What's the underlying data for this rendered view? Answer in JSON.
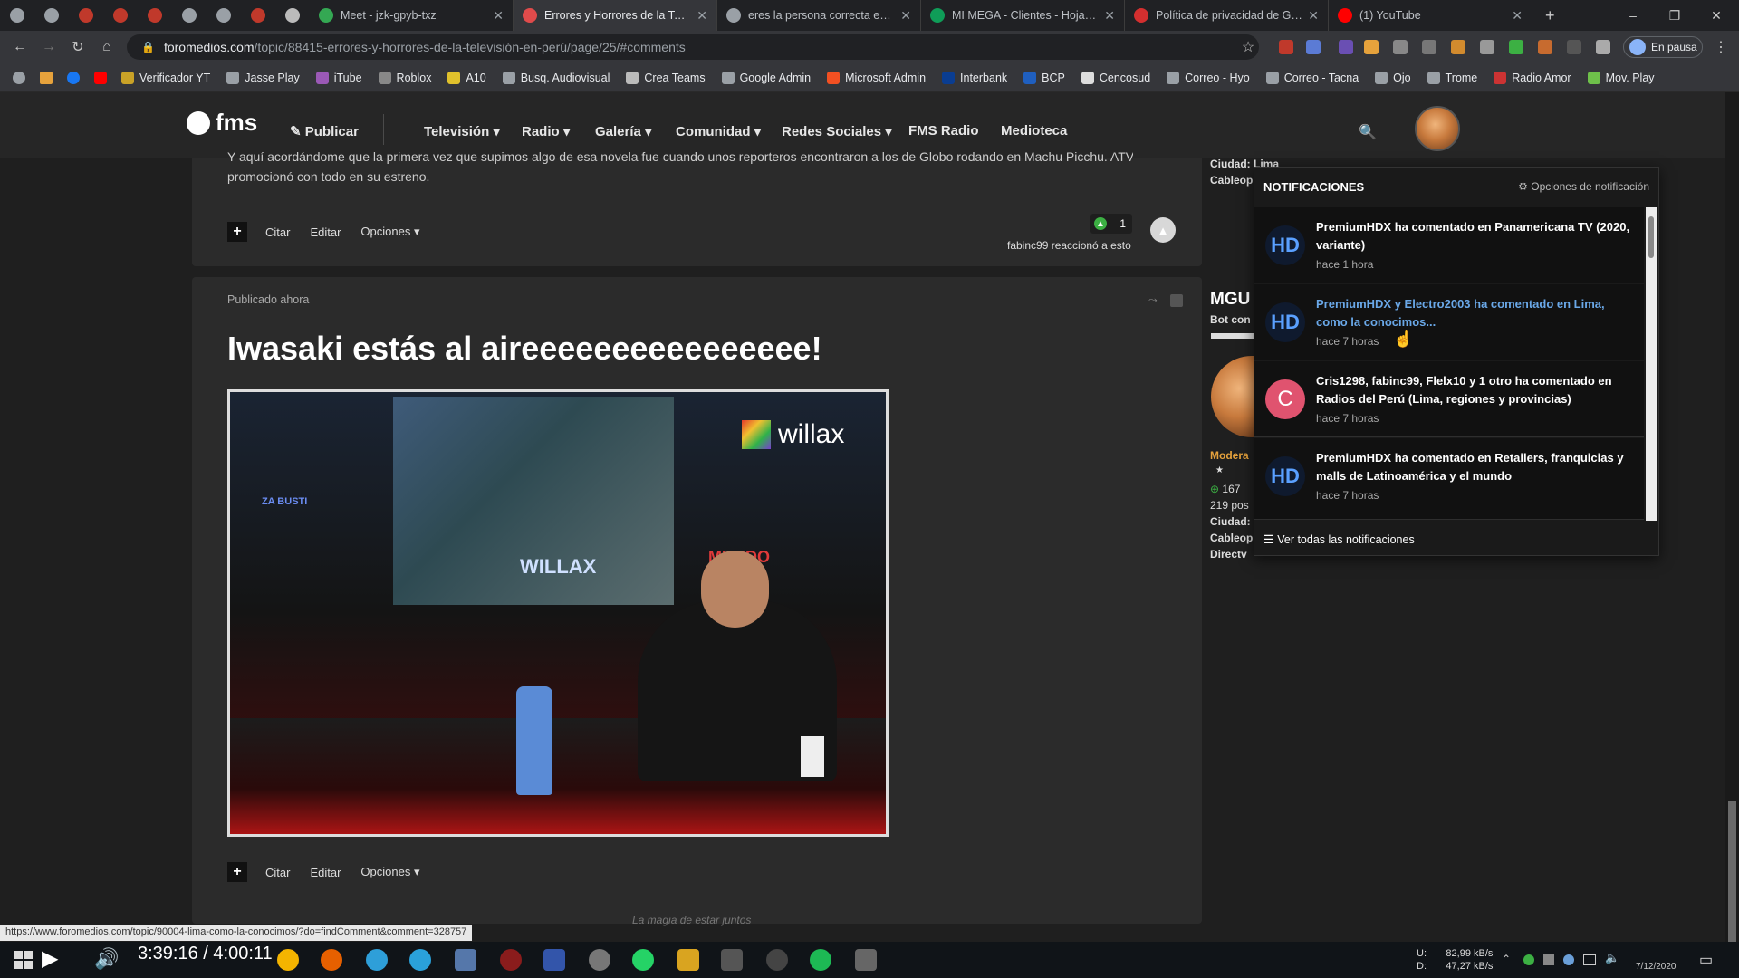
{
  "browser": {
    "tabs": [
      {
        "label": "Meet - jzk-gpyb-txz",
        "color": "#34a853"
      },
      {
        "label": "Errores y Horrores de la Televi",
        "color": "#e04b4b",
        "active": true
      },
      {
        "label": "eres la persona correcta en el",
        "color": "#9aa0a6"
      },
      {
        "label": "MI MEGA - Clientes - Hojas de",
        "color": "#0f9d58"
      },
      {
        "label": "Política de privacidad de Gob",
        "color": "#d32f2f"
      },
      {
        "label": "(1) YouTube",
        "color": "#ff0000"
      }
    ],
    "new_tab": "+",
    "url_host": "foromedios.com",
    "url_path": "/topic/88415-errores-y-horrores-de-la-televisión-en-perú/page/25/#comments",
    "profile_status": "En pausa",
    "bookmarks": [
      {
        "label": "Verificador YT",
        "color": "#c9a227"
      },
      {
        "label": "Jasse Play",
        "color": "#9aa0a6"
      },
      {
        "label": "iTube",
        "color": "#9b59b6"
      },
      {
        "label": "Roblox",
        "color": "#888888"
      },
      {
        "label": "A10",
        "color": "#e0c12c"
      },
      {
        "label": "Busq. Audiovisual",
        "color": "#9aa0a6"
      },
      {
        "label": "Crea Teams",
        "color": "#bbbbbb"
      },
      {
        "label": "Google Admin",
        "color": "#9aa0a6"
      },
      {
        "label": "Microsoft Admin",
        "color": "#f25022"
      },
      {
        "label": "Interbank",
        "color": "#0a3d91"
      },
      {
        "label": "BCP",
        "color": "#1f5fbf"
      },
      {
        "label": "Cencosud",
        "color": "#dddddd"
      },
      {
        "label": "Correo - Hyo",
        "color": "#9aa0a6"
      },
      {
        "label": "Correo - Tacna",
        "color": "#9aa0a6"
      },
      {
        "label": "Ojo",
        "color": "#9aa0a6"
      },
      {
        "label": "Trome",
        "color": "#9aa0a6"
      },
      {
        "label": "Radio Amor",
        "color": "#cc3333"
      },
      {
        "label": "Mov. Play",
        "color": "#6ec04a"
      }
    ]
  },
  "site": {
    "logo": "fms",
    "publish": "Publicar",
    "nav": [
      "Televisión ▾",
      "Radio ▾",
      "Galería ▾",
      "Comunidad ▾",
      "Redes Sociales ▾",
      "FMS Radio",
      "Medioteca"
    ]
  },
  "post1": {
    "text_line1": "Y aquí acordándome que la primera vez que supimos algo de esa novela fue cuando unos reporteros encontraron a los de Globo rodando en Machu Picchu. ATV la",
    "text_line2": "promocionó con todo en su estreno.",
    "actions": [
      "Citar",
      "Editar",
      "Opciones ▾"
    ],
    "reaction_count": "1",
    "reaction_note": "fabinc99 reaccionó a esto"
  },
  "post2": {
    "published": "Publicado ahora",
    "title": "Iwasaki estás al aireeeeeeeeeeeeeeee!",
    "image_watermark": "willax",
    "image_screen_text": "WILLAX",
    "image_sign_left": "ZA BUSTI",
    "image_sign_right": "MUNDO",
    "actions": [
      "Citar",
      "Editar",
      "Opciones ▾"
    ]
  },
  "author_top": {
    "city_label": "Ciudad:",
    "city_value": "Lima",
    "cable_label": "Cableop"
  },
  "author_side": {
    "name": "MGU",
    "role": "Bot con",
    "group": "Modera",
    "rep": "167",
    "posts": "219 pos",
    "city_label": "Ciudad:",
    "cable_label": "Cableop",
    "cable_value": "Directv"
  },
  "notifications": {
    "title": "NOTIFICACIONES",
    "options": "Opciones de notificación",
    "items": [
      {
        "text": "PremiumHDX ha comentado en Panamericana TV (2020, variante)",
        "time": "hace 1 hora",
        "avatar": "HD"
      },
      {
        "text": "PremiumHDX y Electro2003 ha comentado en Lima, como la conocimos...",
        "time": "hace 7 horas",
        "avatar": "HD",
        "hover": true
      },
      {
        "text": "Cris1298, fabinc99, Flelx10 y 1 otro ha comentado en Radios del Perú (Lima, regiones y provincias)",
        "time": "hace 7 horas",
        "avatar": "C"
      },
      {
        "text": "PremiumHDX ha comentado en Retailers, franquicias y malls de Latinoamérica y el mundo",
        "time": "hace 7 horas",
        "avatar": "HD"
      }
    ],
    "view_all": "Ver todas las notificaciones"
  },
  "footer": {
    "motto": "La magia de estar juntos",
    "status_url": "https://www.foromedios.com/topic/90004-lima-como-la-conocimos/?do=findComment&comment=328757"
  },
  "player": {
    "time": "3:39:16 / 4:00:11"
  },
  "tray": {
    "upload_label": "U:",
    "upload_value": "82,99 kB/s",
    "download_label": "D:",
    "download_value": "47,27 kB/s",
    "date": "7/12/2020"
  }
}
